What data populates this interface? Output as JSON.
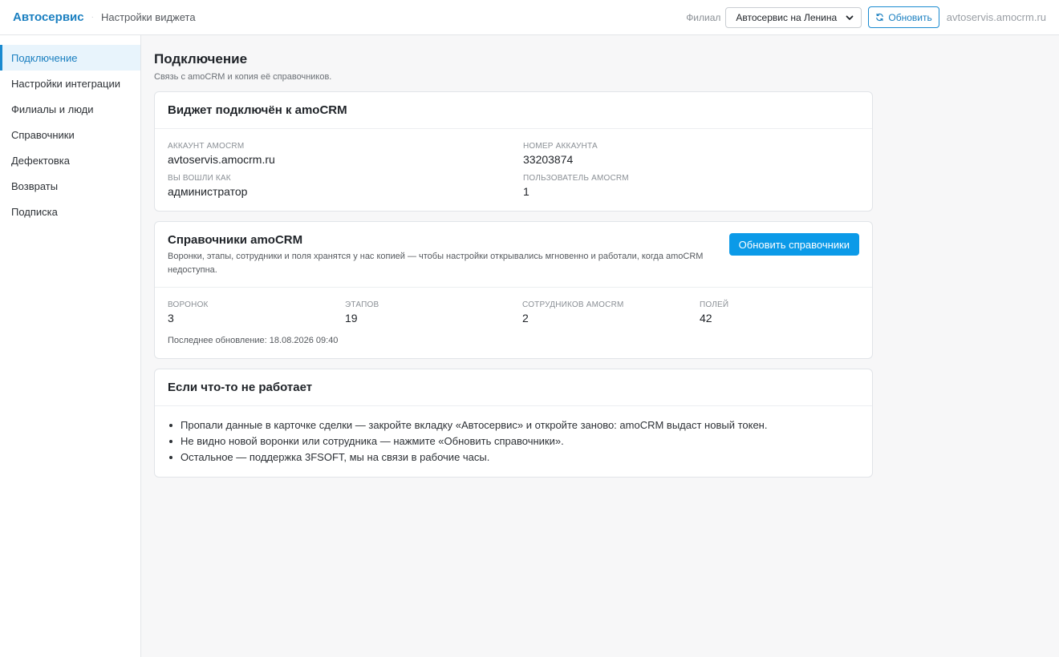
{
  "header": {
    "brand": "Автосервис",
    "separator": "·",
    "breadcrumb": "Настройки виджета",
    "branch_label": "Филиал",
    "branch_selected": "Автосервис на Ленина",
    "refresh_label": "Обновить",
    "domain": "avtoservis.amocrm.ru"
  },
  "sidebar": {
    "items": [
      {
        "label": "Подключение"
      },
      {
        "label": "Настройки интеграции"
      },
      {
        "label": "Филиалы и люди"
      },
      {
        "label": "Справочники"
      },
      {
        "label": "Дефектовка"
      },
      {
        "label": "Возвраты"
      },
      {
        "label": "Подписка"
      }
    ],
    "active_index": 0
  },
  "main": {
    "title": "Подключение",
    "subtitle": "Связь с amoCRM и копия её справочников.",
    "connection": {
      "title": "Виджет подключён к amoCRM",
      "fields": [
        {
          "label": "Аккаунт amoCRM",
          "value": "avtoservis.amocrm.ru"
        },
        {
          "label": "Номер аккаунта",
          "value": "33203874"
        },
        {
          "label": "Вы вошли как",
          "value": "администратор"
        },
        {
          "label": "Пользователь amoCRM",
          "value": "1"
        }
      ]
    },
    "directories": {
      "title": "Справочники amoCRM",
      "description": "Воронки, этапы, сотрудники и поля хранятся у нас копией — чтобы настройки открывались мгновенно и работали, когда amoCRM недоступна.",
      "button_label": "Обновить справочники",
      "stats": [
        {
          "label": "Воронок",
          "value": "3"
        },
        {
          "label": "Этапов",
          "value": "19"
        },
        {
          "label": "Сотрудников amoCRM",
          "value": "2"
        },
        {
          "label": "Полей",
          "value": "42"
        }
      ],
      "last_update": "Последнее обновление: 18.08.2026 09:40"
    },
    "help": {
      "title": "Если что-то не работает",
      "items": [
        "Пропали данные в карточке сделки — закройте вкладку «Автосервис» и откройте заново: amoCRM выдаст новый токен.",
        "Не видно новой воронки или сотрудника — нажмите «Обновить справочники».",
        "Остальное — поддержка 3FSOFT, мы на связи в рабочие часы."
      ]
    }
  },
  "colors": {
    "accent": "#1a7fc0",
    "primary_button": "#0b9ae8",
    "active_nav_bg": "#e8f4fc"
  },
  "icons": {
    "refresh": "refresh-icon",
    "select": "chevron-down-icon"
  }
}
